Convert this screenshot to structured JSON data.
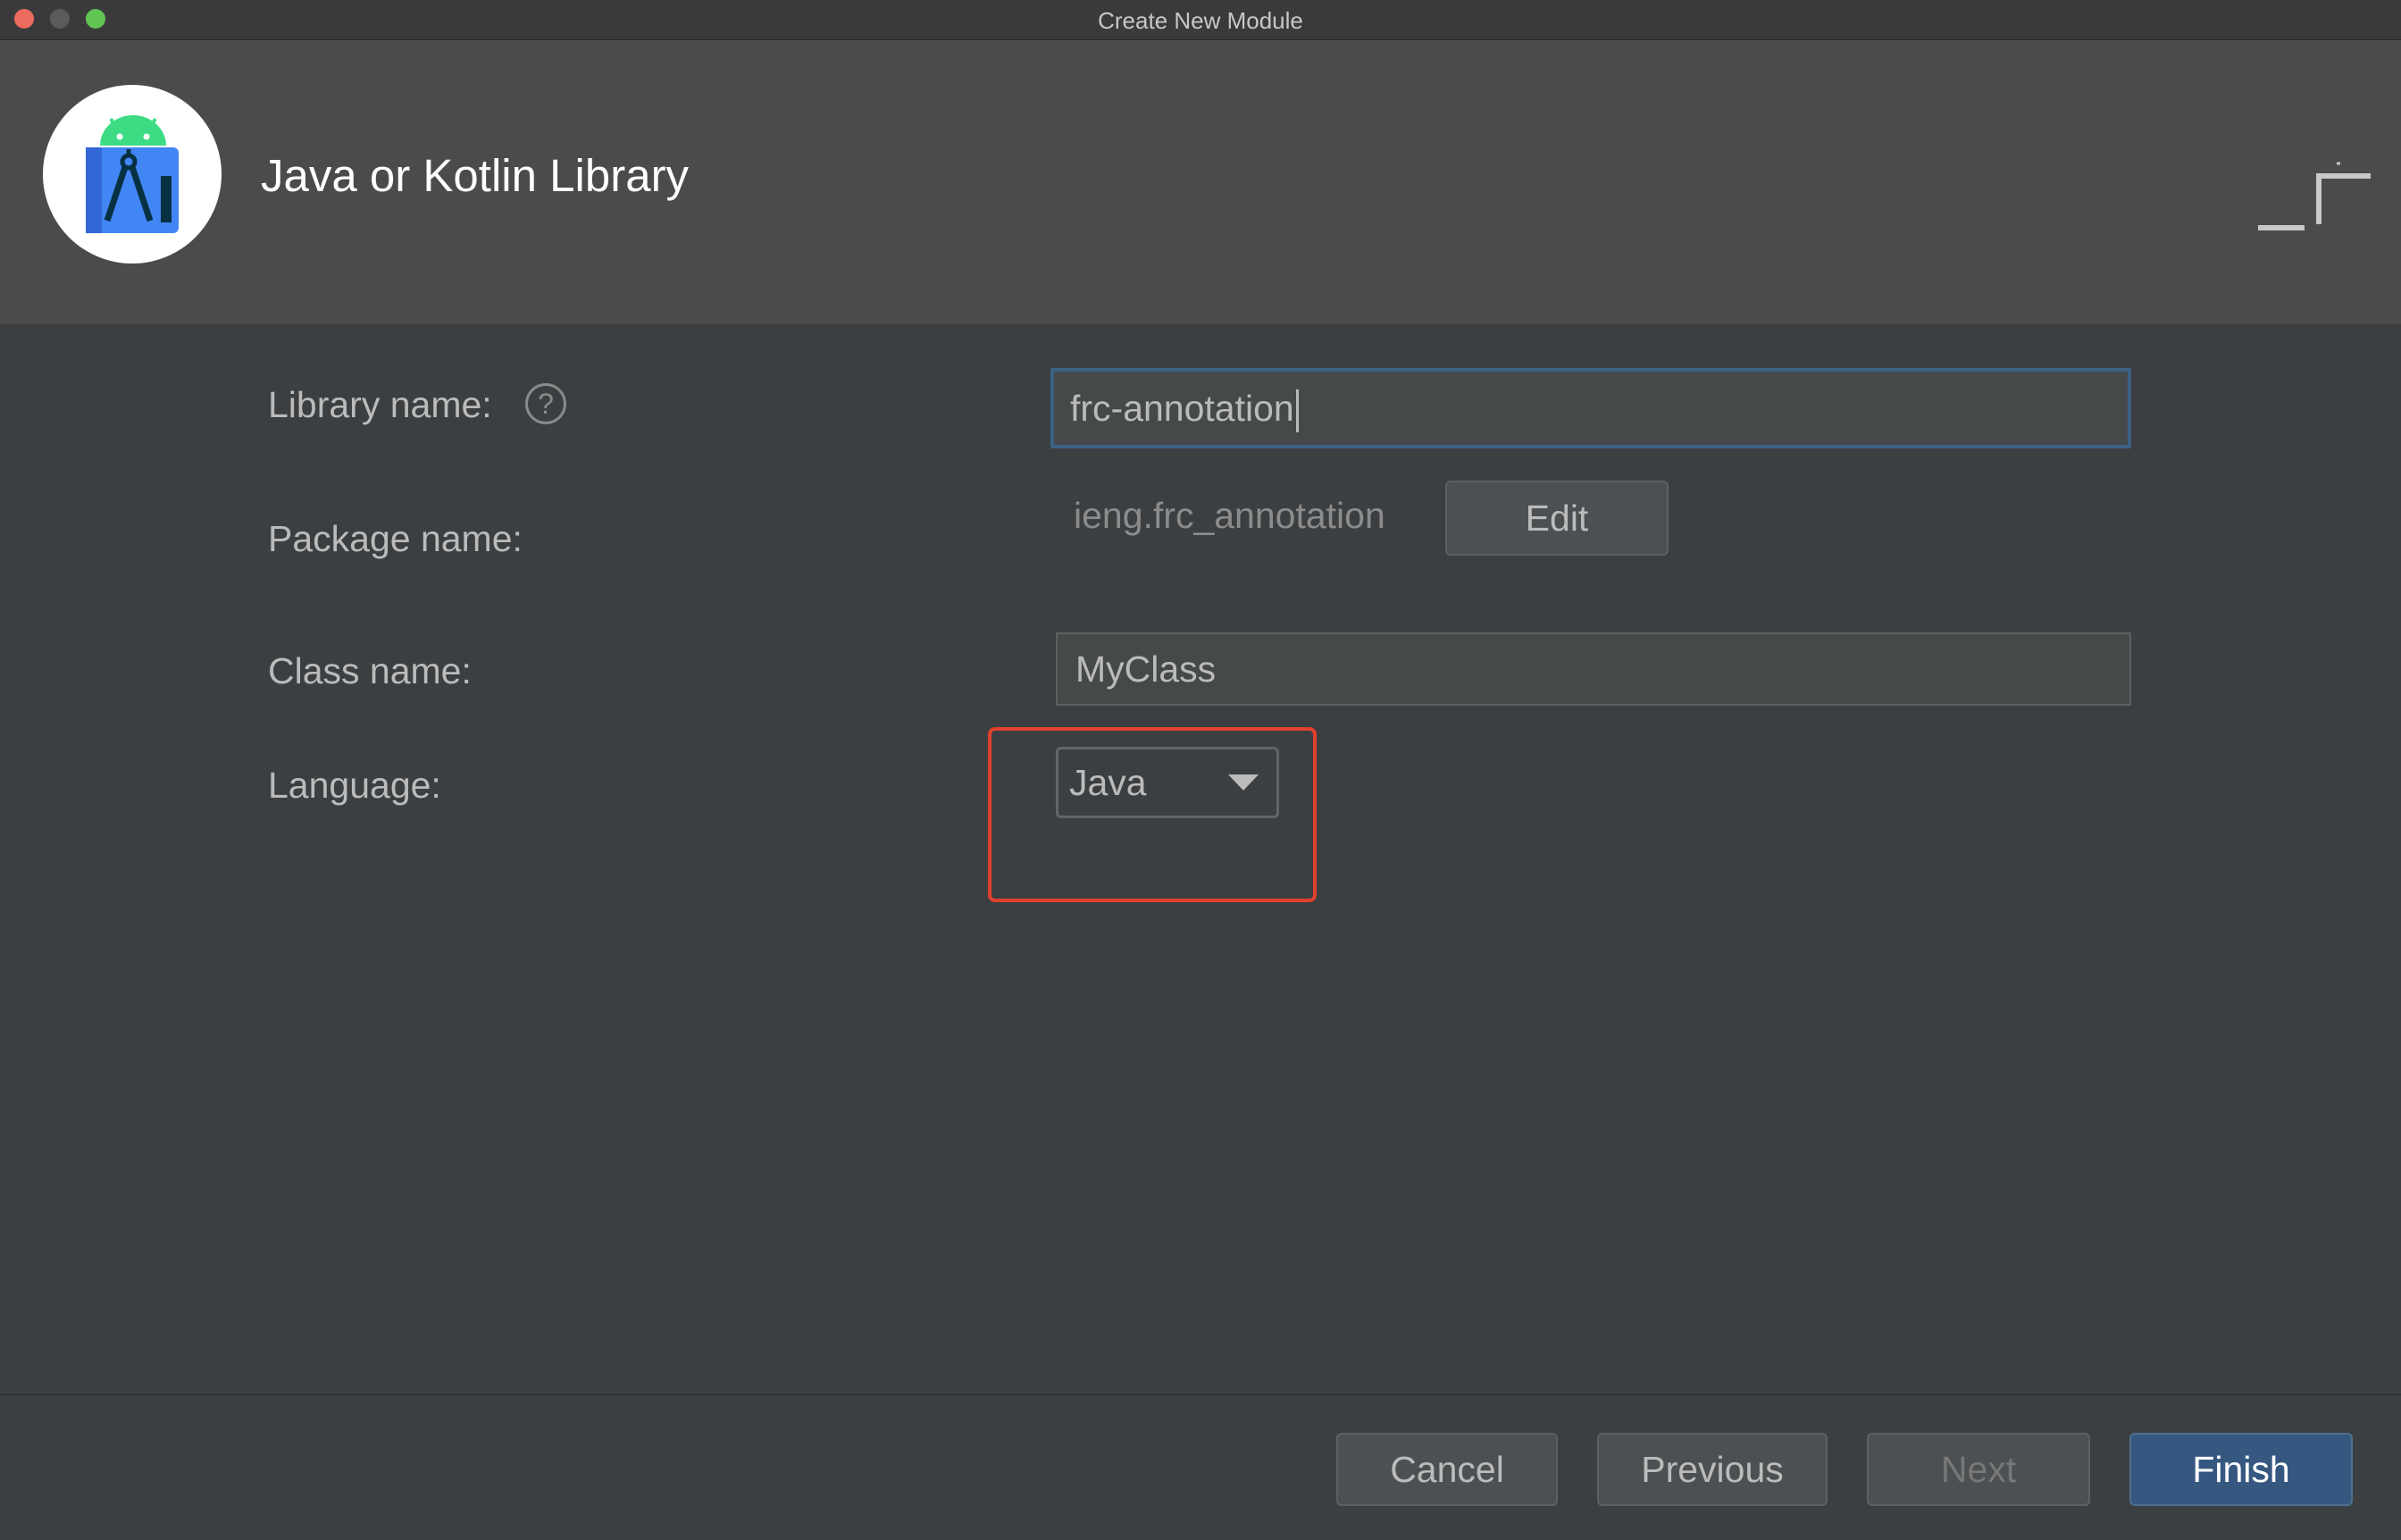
{
  "window": {
    "title": "Create New Module"
  },
  "header": {
    "title": "Java or Kotlin Library",
    "logo_icon": "android-studio-icon"
  },
  "form": {
    "library_name": {
      "label": "Library name:",
      "value": "frc-annotation",
      "help_icon": "help-icon",
      "help_glyph": "?"
    },
    "package_name": {
      "label": "Package name:",
      "value": "ieng.frc_annotation",
      "edit_label": "Edit"
    },
    "class_name": {
      "label": "Class name:",
      "value": "MyClass"
    },
    "language": {
      "label": "Language:",
      "selected": "Java",
      "arrow_icon": "chevron-down-icon"
    }
  },
  "footer": {
    "cancel_label": "Cancel",
    "previous_label": "Previous",
    "next_label": "Next",
    "finish_label": "Finish"
  },
  "colors": {
    "highlight": "#e0412d",
    "primary_button": "#365880",
    "focus_border": "#3d6185"
  }
}
